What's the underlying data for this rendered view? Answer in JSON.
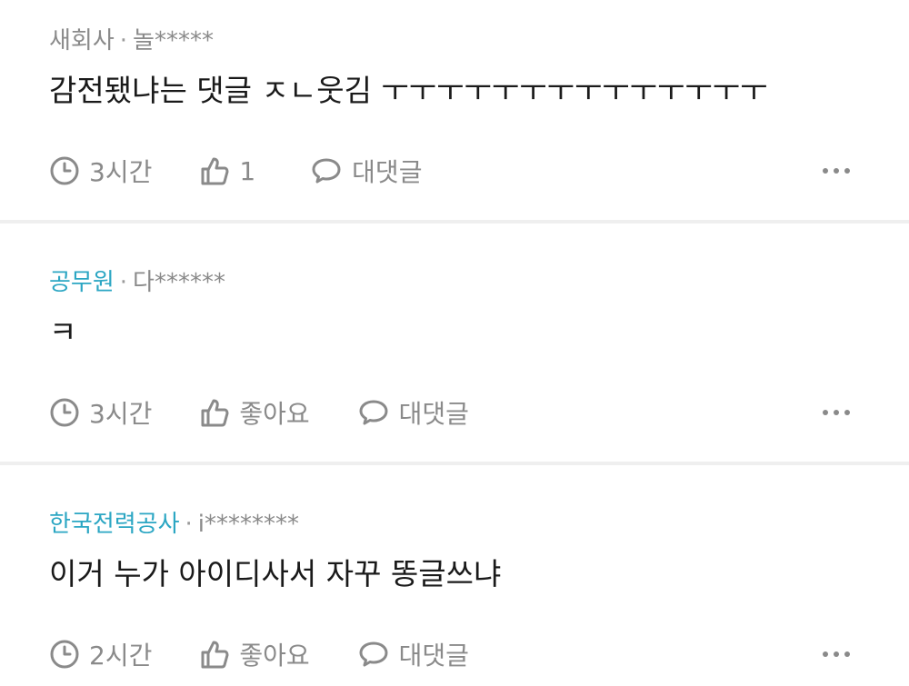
{
  "comments": [
    {
      "company": "새회사",
      "separator": "·",
      "user": "놀*****",
      "body": "감전됐냐는 댓글 ㅈㄴ웃김 ㅜㅜㅜㅜㅜㅜㅜㅜㅜㅜㅜㅜㅜㅜ",
      "time": "3시간",
      "like": "1",
      "reply": "대댓글"
    },
    {
      "company": "공무원",
      "separator": "·",
      "user": "다******",
      "body": "ㅋ",
      "time": "3시간",
      "like": "좋아요",
      "reply": "대댓글"
    },
    {
      "company": "한국전력공사",
      "separator": "·",
      "user": "i********",
      "body": "이거 누가 아이디사서 자꾸 똥글쓰냐",
      "time": "2시간",
      "like": "좋아요",
      "reply": "대댓글"
    }
  ],
  "icons": {
    "time": "clock-icon",
    "like": "thumbs-up-icon",
    "reply": "speech-bubble-icon",
    "more": "more-dots-icon"
  },
  "colors": {
    "company_link": "#2ba6c3",
    "meta_gray": "#8a8a8a",
    "divider": "#efefef"
  }
}
